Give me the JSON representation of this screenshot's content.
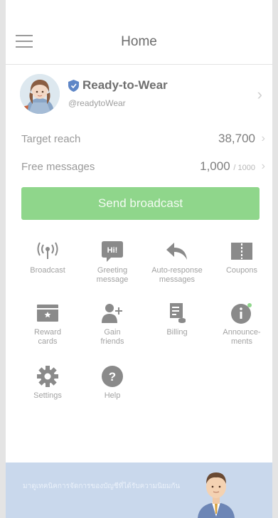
{
  "header": {
    "title": "Home"
  },
  "account": {
    "name": "Ready-to-Wear",
    "id": "@readytoWear"
  },
  "stats": {
    "target_label": "Target reach",
    "target_value": "38,700",
    "free_label": "Free messages",
    "free_value": "1,000",
    "free_total": "/ 1000"
  },
  "send_button": "Send broadcast",
  "tiles": [
    {
      "label": "Broadcast",
      "icon": "broadcast-icon"
    },
    {
      "label": "Greeting\nmessage",
      "icon": "greeting-icon",
      "icon_text": "Hi!"
    },
    {
      "label": "Auto-response\nmessages",
      "icon": "reply-arrow-icon"
    },
    {
      "label": "Coupons",
      "icon": "coupon-icon"
    },
    {
      "label": "Reward\ncards",
      "icon": "reward-card-icon"
    },
    {
      "label": "Gain\nfriends",
      "icon": "add-friend-icon"
    },
    {
      "label": "Billing",
      "icon": "billing-icon"
    },
    {
      "label": "Announce-\nments",
      "icon": "announcement-icon"
    },
    {
      "label": "Settings",
      "icon": "gear-icon"
    },
    {
      "label": "Help",
      "icon": "help-icon"
    }
  ],
  "banner": {
    "text": "มาดูเทคนิคการจัดการของบัญชีที่ได้รับความนิยมกัน"
  },
  "colors": {
    "accent": "#8fd68b",
    "icon_gray": "#8a8a8a",
    "banner_bg": "#c9d8ec"
  }
}
